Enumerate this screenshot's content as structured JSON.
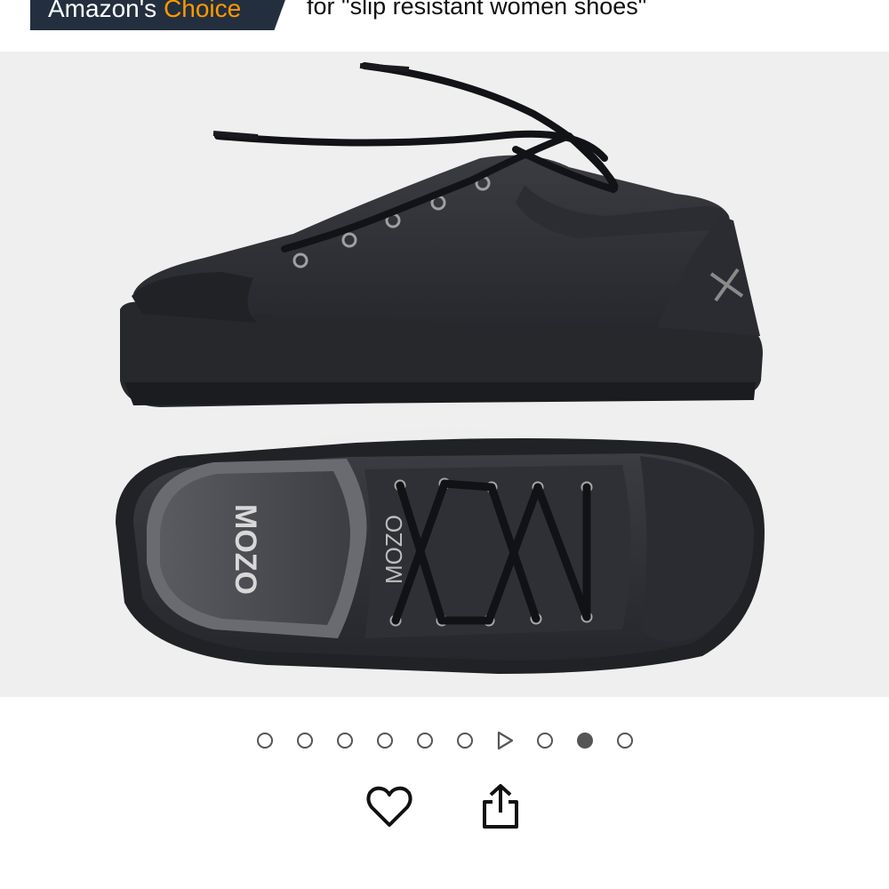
{
  "badge": {
    "amazon_label": "Amazon's",
    "choice_label": "Choice",
    "for_text": "for \"slip resistant women shoes\""
  },
  "product_image": {
    "brand_text": "MOZO",
    "alt": "Black shoes"
  },
  "carousel": {
    "total_items": 10,
    "active_index": 8,
    "video_index": 6
  },
  "actions": {
    "heart_icon": "heart-icon",
    "share_icon": "share-icon"
  },
  "colors": {
    "badge_bg": "#232f3e",
    "choice_accent": "#ff9900"
  }
}
